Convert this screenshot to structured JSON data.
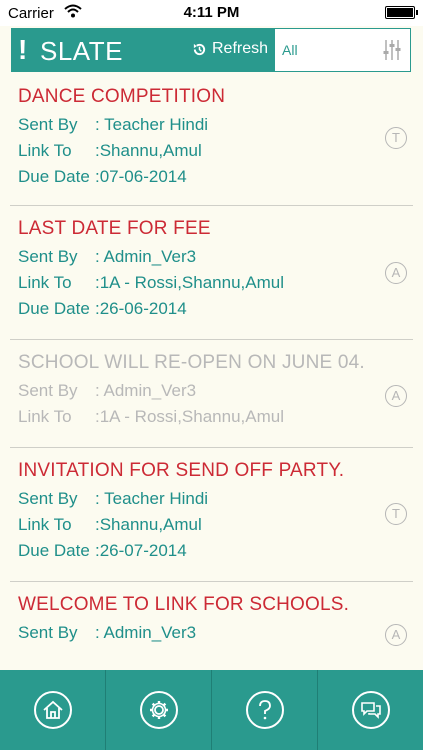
{
  "status_bar": {
    "carrier": "Carrier",
    "time": "4:11 PM"
  },
  "header": {
    "brand": "SLATE",
    "refresh_label": "Refresh",
    "filter_value": "All"
  },
  "labels": {
    "sent_by": "Sent By",
    "link_to": "Link To",
    "due_date": "Due Date"
  },
  "messages": [
    {
      "title": "DANCE COMPETITION",
      "sent_by": ": Teacher Hindi",
      "link_to": ":Shannu,Amul",
      "due_date": ":07-06-2014",
      "badge": "T"
    },
    {
      "title": "LAST DATE FOR FEE",
      "sent_by": ": Admin_Ver3",
      "link_to": ":1A - Rossi,Shannu,Amul",
      "due_date": ":26-06-2014",
      "badge": "A"
    },
    {
      "title": "SCHOOL WILL RE-OPEN ON JUNE 04.",
      "sent_by": ": Admin_Ver3",
      "link_to": ":1A - Rossi,Shannu,Amul",
      "badge": "A"
    },
    {
      "title": "INVITATION FOR SEND OFF PARTY.",
      "sent_by": ": Teacher Hindi",
      "link_to": ":Shannu,Amul",
      "due_date": ":26-07-2014",
      "badge": "T"
    },
    {
      "title": "WELCOME TO LINK FOR SCHOOLS.",
      "sent_by": ": Admin_Ver3",
      "badge": "A"
    }
  ],
  "tab_bar": [
    "home-icon",
    "settings-icon",
    "help-icon",
    "chat-icon"
  ],
  "colors": {
    "teal": "#2a9a8e",
    "title_red": "#cc2a35",
    "muted_gray": "#b8b8b8",
    "background": "#fcfbf0"
  }
}
